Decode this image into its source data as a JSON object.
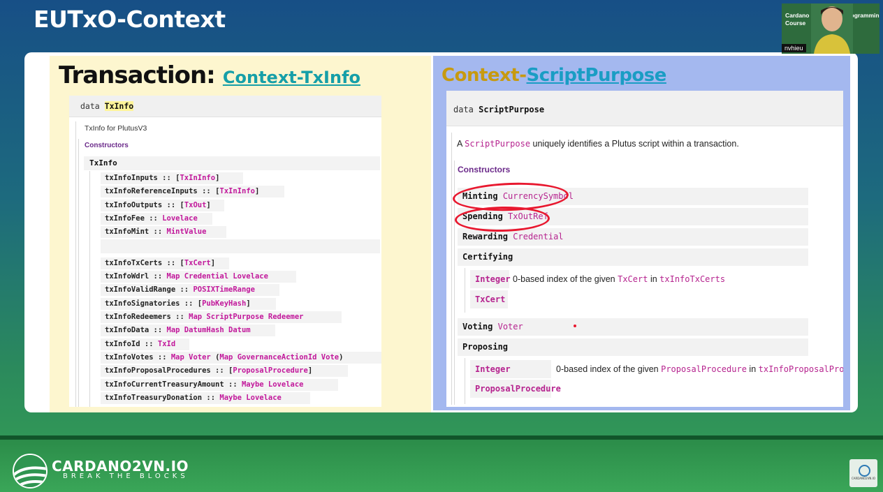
{
  "slide": {
    "title": "EUTxO-Context"
  },
  "left": {
    "heading_main": "Transaction:",
    "heading_link": "Context-TxInfo",
    "doc": {
      "data_keyword": "data",
      "data_name": "TxInfo",
      "description": "TxInfo for PlutusV3",
      "constructors_label": "Constructors",
      "constructor_name": "TxInfo",
      "fields": [
        {
          "name": "txInfoInputs",
          "sep": " :: ",
          "pre": "[",
          "type": "TxInInfo",
          "post": "]"
        },
        {
          "name": "txInfoReferenceInputs",
          "sep": " :: ",
          "pre": "[",
          "type": "TxInInfo",
          "post": "]"
        },
        {
          "name": "txInfoOutputs",
          "sep": " :: ",
          "pre": "[",
          "type": "TxOut",
          "post": "]"
        },
        {
          "name": "txInfoFee",
          "sep": " :: ",
          "pre": "",
          "type": "Lovelace",
          "post": ""
        },
        {
          "name": "txInfoMint",
          "sep": " :: ",
          "pre": "",
          "type": "MintValue",
          "post": ""
        },
        {
          "name": "txInfoTxCerts",
          "sep": " :: ",
          "pre": "[",
          "type": "TxCert",
          "post": "]"
        },
        {
          "name": "txInfoWdrl",
          "sep": " :: ",
          "pre": "",
          "type": "Map Credential Lovelace",
          "post": ""
        },
        {
          "name": "txInfoValidRange",
          "sep": " :: ",
          "pre": "",
          "type": "POSIXTimeRange",
          "post": ""
        },
        {
          "name": "txInfoSignatories",
          "sep": " :: ",
          "pre": "[",
          "type": "PubKeyHash",
          "post": "]"
        },
        {
          "name": "txInfoRedeemers",
          "sep": " :: ",
          "pre": "",
          "type": "Map ScriptPurpose Redeemer",
          "post": ""
        },
        {
          "name": "txInfoData",
          "sep": " :: ",
          "pre": "",
          "type": "Map DatumHash Datum",
          "post": ""
        },
        {
          "name": "txInfoId",
          "sep": " :: ",
          "pre": "",
          "type": "TxId",
          "post": ""
        },
        {
          "name": "txInfoVotes",
          "sep": " :: ",
          "pre": "",
          "type": "Map Voter",
          "post": " (",
          "type2": "Map GovernanceActionId Vote",
          "post2": ")"
        },
        {
          "name": "txInfoProposalProcedures",
          "sep": " :: ",
          "pre": "[",
          "type": "ProposalProcedure",
          "post": "]"
        },
        {
          "name": "txInfoCurrentTreasuryAmount",
          "sep": " :: ",
          "pre": "",
          "type": "Maybe Lovelace",
          "post": ""
        },
        {
          "name": "txInfoTreasuryDonation",
          "sep": " :: ",
          "pre": "",
          "type": "Maybe Lovelace",
          "post": ""
        }
      ]
    }
  },
  "right": {
    "heading_prefix": "Context-",
    "heading_link": "ScriptPurpose",
    "doc": {
      "data_keyword": "data",
      "data_name": "ScriptPurpose",
      "desc_a": "A ",
      "desc_code": "ScriptPurpose",
      "desc_b": " uniquely identifies a Plutus script within a transaction.",
      "constructors_label": "Constructors",
      "rows": [
        {
          "name": "Minting",
          "arg": "CurrencySymbol"
        },
        {
          "name": "Spending",
          "arg": "TxOutRef"
        },
        {
          "name": "Rewarding",
          "arg": "Credential"
        },
        {
          "name": "Certifying",
          "arg": ""
        },
        {
          "name": "Voting",
          "arg": "Voter"
        },
        {
          "name": "Proposing",
          "arg": ""
        }
      ],
      "certifying_fields": [
        {
          "name": "Integer",
          "desc_a": "0-based index of the given ",
          "code_a": "TxCert",
          "desc_b": " in ",
          "code_b": "txInfoTxCerts"
        },
        {
          "name": "TxCert"
        }
      ],
      "proposing_fields": [
        {
          "name": "Integer",
          "desc_a": "0-based index of the given ",
          "code_a": "ProposalProcedure",
          "desc_b": " in ",
          "code_b": "txInfoProposalProcedures"
        },
        {
          "name": "ProposalProcedure"
        }
      ]
    }
  },
  "webcam": {
    "line1": "Cardano Blockchain Programming",
    "line2": "Course",
    "name": "nvhieu"
  },
  "footer": {
    "brand": "CARDANO2VN.IO",
    "tagline": "BREAK THE BLOCKS",
    "corner_text": "CARDANO2VN.IO"
  },
  "colors": {
    "annotation": "#e8182f",
    "left_panel": "#fdf6cf",
    "right_panel": "#a4b8ef",
    "code_magenta": "#c2189b"
  }
}
